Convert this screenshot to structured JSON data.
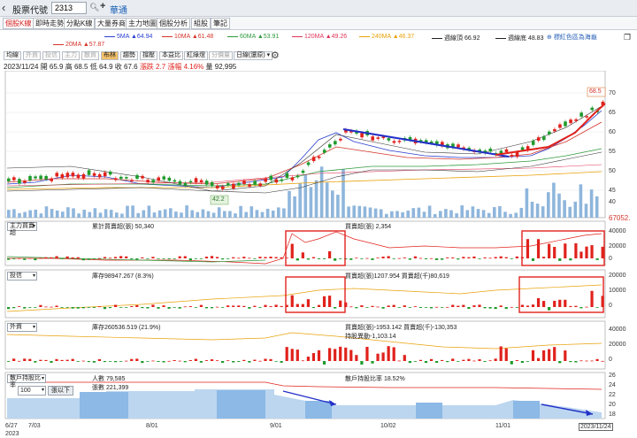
{
  "header": {
    "field_label": "股票代號",
    "code_value": "2313",
    "stock_name": "華通"
  },
  "tabs": [
    {
      "label": "個股K線",
      "active": true
    },
    {
      "label": "即時走勢",
      "active": false
    },
    {
      "label": "分點K線",
      "active": false
    },
    {
      "label": "大量券商",
      "active": false
    },
    {
      "label": "主力地圖",
      "active": false
    },
    {
      "label": "個股分析",
      "active": false
    },
    {
      "label": "組股",
      "active": false
    },
    {
      "label": "筆記",
      "active": false
    }
  ],
  "ma_legend": [
    {
      "label": "5MA ▲64.94",
      "color": "#2b3fcf"
    },
    {
      "label": "10MA ▲61.48",
      "color": "#d4352b"
    },
    {
      "label": "60MA ▲53.91",
      "color": "#2f9a3c"
    },
    {
      "label": "120MA ▲49.26",
      "color": "#e0345a"
    },
    {
      "label": "240MA ▲46.37",
      "color": "#e8a20b"
    },
    {
      "label": "週線頂 66.92",
      "color": "#222222"
    },
    {
      "label": "週線底 48.83",
      "color": "#222222"
    },
    {
      "label": "20MA ▲57.87",
      "color": "#d4352b"
    }
  ],
  "corner_button": "標紅色區為海龜",
  "toolbar": [
    {
      "label": "均線",
      "dim": false
    },
    {
      "label": "外資",
      "dim": true
    },
    {
      "label": "投信",
      "dim": true
    },
    {
      "label": "主力",
      "dim": true
    },
    {
      "label": "散資",
      "dim": true
    },
    {
      "label": "布林",
      "dim": false,
      "sel": true
    },
    {
      "label": "趨勢",
      "dim": false
    },
    {
      "label": "撐壓",
      "dim": false
    },
    {
      "label": "本益比",
      "dim": false
    },
    {
      "label": "紅綠燈",
      "dim": false
    },
    {
      "label": "分價量",
      "dim": true
    },
    {
      "label": "日線(還原)",
      "dim": false
    }
  ],
  "quote": {
    "date": "2023/11/24",
    "open": "開 65.9",
    "high": "高 68.5",
    "low": "低 64.9",
    "close": "收 67.6",
    "change": "漲跌 2.7",
    "pct": "漲幅 4.16%",
    "volume": "量 92,995"
  },
  "price_axis": [
    "70",
    "65",
    "60",
    "55",
    "50",
    "45",
    "40"
  ],
  "price_high_label": "68.5",
  "price_low_label": "42.2",
  "volume_max_label": "67052.",
  "panels": [
    {
      "selector": "主力買賣超",
      "line1": "累計買賣超(張) 50,340",
      "line2": "買賣超(張) 2,354",
      "axis": [
        "40000",
        "20000",
        "0"
      ]
    },
    {
      "selector": "投信",
      "line1": "庫存98947.267 (8.3%)",
      "line2": "買賣超(張)1207.954 買賣超(千)80,619",
      "axis": [
        "20000",
        "10000",
        "0"
      ]
    },
    {
      "selector": "外資",
      "line1": "庫存260536.519 (21.9%)",
      "line2": "買賣超(張)-1953.142 買賣超(千)-130,353",
      "line3": "持股異動-1,103.14",
      "axis": [
        "40000",
        "20000",
        "0"
      ]
    },
    {
      "selector": "散戶持股比率",
      "line1": "人數 79,585",
      "line2": "散戶持股比率 18.52%",
      "line3": "張數 221,399",
      "axis": [
        "26",
        "24",
        "22",
        "20",
        "18"
      ]
    }
  ],
  "bottom_controls": {
    "select_value": "100",
    "button_label": "張以下"
  },
  "x_axis": [
    {
      "label": "6/27"
    },
    {
      "label": "7/03"
    },
    {
      "label": "8/01"
    },
    {
      "label": "9/01"
    },
    {
      "label": "10/02"
    },
    {
      "label": "11/01"
    },
    {
      "label": "2023/11/24"
    },
    {
      "label": "2023"
    }
  ],
  "colors": {
    "up": "#e0221c",
    "down": "#1f9a2c",
    "accent": "#1a5fb4",
    "volume": "#8fb6dc"
  }
}
